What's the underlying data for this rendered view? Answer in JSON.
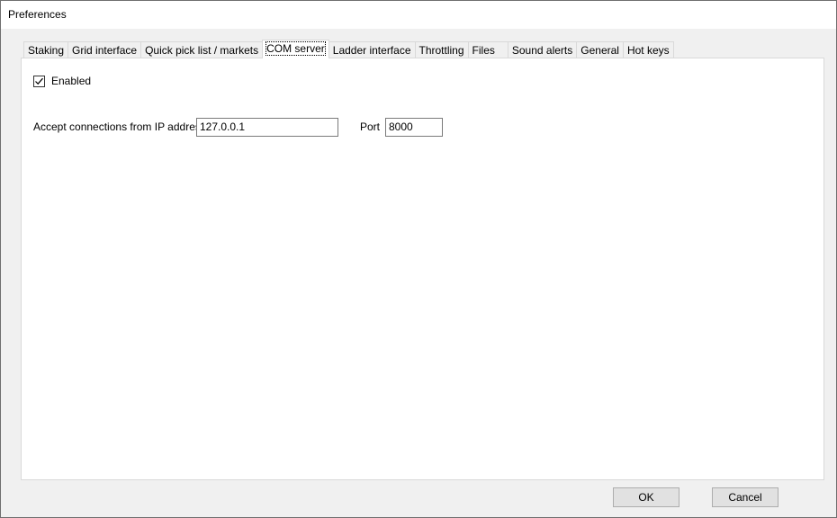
{
  "window": {
    "title": "Preferences"
  },
  "tabs": [
    {
      "label": "Staking",
      "active": false
    },
    {
      "label": "Grid interface",
      "active": false
    },
    {
      "label": "Quick pick list / markets",
      "active": false
    },
    {
      "label": "COM server",
      "active": true
    },
    {
      "label": "Ladder interface",
      "active": false
    },
    {
      "label": "Throttling",
      "active": false
    },
    {
      "label": "Files",
      "active": false
    },
    {
      "label": "Sound alerts",
      "active": false
    },
    {
      "label": "General",
      "active": false
    },
    {
      "label": "Hot keys",
      "active": false
    }
  ],
  "com_server": {
    "enabled_label": "Enabled",
    "enabled_checked": true,
    "ip_label": "Accept connections from IP address",
    "ip_value": "127.0.0.1",
    "port_label": "Port",
    "port_value": "8000"
  },
  "buttons": {
    "ok": "OK",
    "cancel": "Cancel"
  },
  "icons": {
    "checkbox_check": "checkmark-icon"
  }
}
